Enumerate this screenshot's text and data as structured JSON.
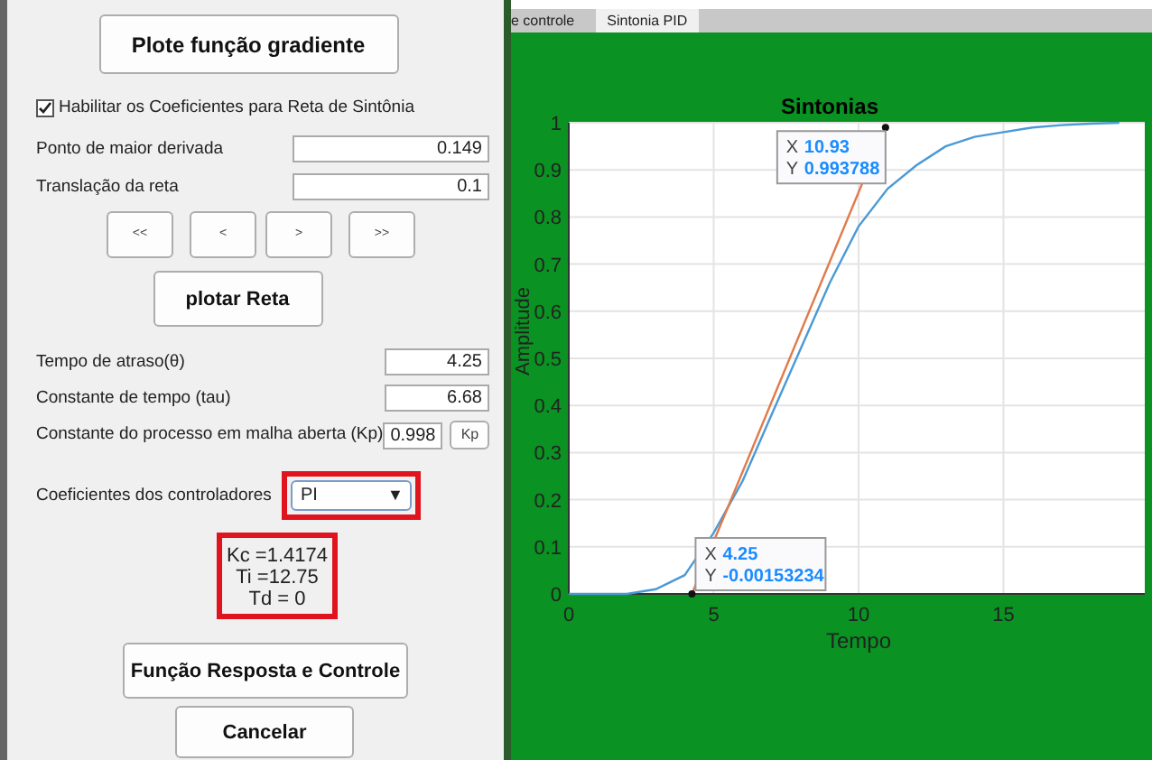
{
  "panel": {
    "plot_gradient_button": "Plote função gradiente",
    "enable_checkbox": {
      "label": "Habilitar os Coeficientes para Reta de Sintônia",
      "checked": true
    },
    "fields1": [
      {
        "label": "Ponto de maior derivada",
        "value": "0.149"
      },
      {
        "label": "Translação da reta",
        "value": "0.1"
      }
    ],
    "nav_buttons": [
      "<<",
      "<",
      ">",
      ">>"
    ],
    "plot_line_button": "plotar Reta",
    "fields2": [
      {
        "label": "Tempo de atraso(θ)",
        "value": "4.25"
      },
      {
        "label": "Constante de tempo (tau)",
        "value": "6.68"
      },
      {
        "label": "Constante do processo em malha aberta (Kp)",
        "value": "0.998",
        "button": "Kp"
      }
    ],
    "controller": {
      "label": "Coeficientes dos controladores",
      "value": "PI",
      "arrow": "▼",
      "highlighted": true
    },
    "results": {
      "lines": [
        "Kc =1.4174",
        "Ti =12.75",
        "Td = 0"
      ],
      "highlighted": true
    },
    "response_button": "Função Resposta e Controle",
    "cancel_button": "Cancelar"
  },
  "tabs": [
    {
      "label": "e controle",
      "selected": false
    },
    {
      "label": "Sintonia PID",
      "selected": true
    }
  ],
  "plot": {
    "chart_data": {
      "type": "line",
      "title": "Sintonias",
      "xlabel": "Tempo",
      "ylabel": "Amplitude",
      "grid": true,
      "x": [
        0,
        1,
        2,
        3,
        4,
        5,
        6,
        7,
        8,
        9,
        10,
        11,
        12,
        13,
        14,
        15,
        16,
        17,
        18,
        19
      ],
      "series": [
        {
          "color": "#4a9ad6",
          "values": [
            0,
            0,
            0,
            0.01,
            0.04,
            0.13,
            0.24,
            0.38,
            0.52,
            0.66,
            0.78,
            0.86,
            0.91,
            0.95,
            0.97,
            0.98,
            0.99,
            0.995,
            0.998,
            1
          ]
        },
        {
          "color": "#e07a4a",
          "marker": true,
          "x": [
            4.25,
            10.93
          ],
          "values": [
            0,
            0.99
          ]
        }
      ],
      "xlim": [
        0,
        20
      ],
      "ylim": [
        0,
        1
      ],
      "xticks": [
        0,
        5,
        10,
        15
      ],
      "yticks": [
        0,
        0.1,
        0.2,
        0.3,
        0.4,
        0.5,
        0.6,
        0.7,
        0.8,
        0.9,
        1
      ]
    },
    "datatips": [
      {
        "x_label": "X",
        "x_value": "10.93",
        "y_label": "Y",
        "y_value": "0.993788"
      },
      {
        "x_label": "X",
        "x_value": "4.25",
        "y_label": "Y",
        "y_value": "-0.00153234"
      }
    ]
  }
}
